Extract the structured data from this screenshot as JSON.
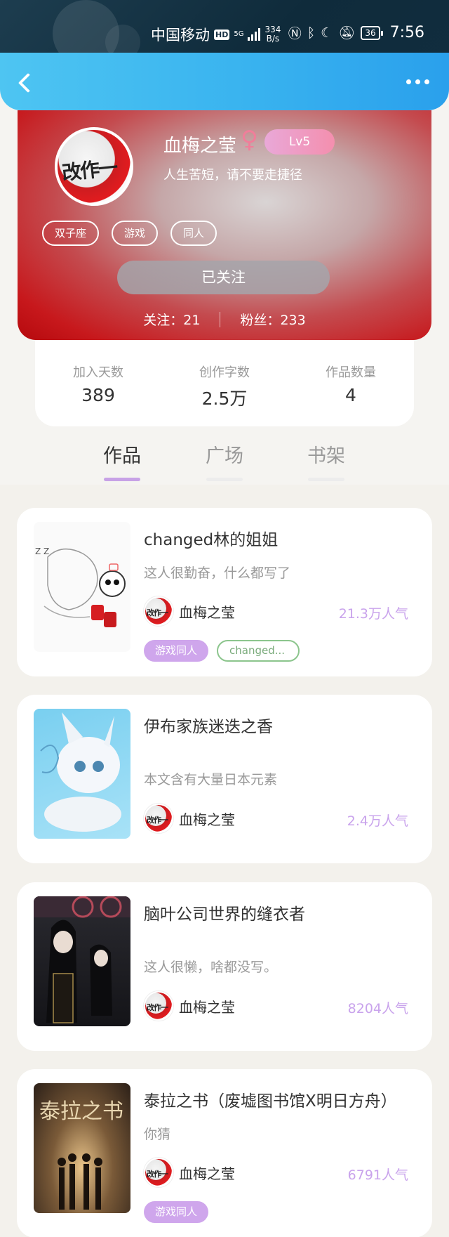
{
  "status_bar": {
    "carrier": "中国移动",
    "hd_badge": "HD",
    "network": "5G",
    "speed_value": "334",
    "speed_unit": "B/s",
    "nfc_icon": "nfc-icon",
    "bluetooth_icon": "bluetooth-icon",
    "moon_icon": "moon-icon",
    "mute_icon": "bell-off-icon",
    "battery": "36",
    "time": "7:56"
  },
  "header": {
    "back_icon": "chevron-left-icon",
    "more_icon": "more-dots-icon"
  },
  "profile": {
    "avatar_text": "改作一",
    "username": "血梅之莹",
    "gender_symbol": "♀",
    "level": "Lv5",
    "motto": "人生苦短，请不要走捷径",
    "tags": [
      "双子座",
      "游戏",
      "同人"
    ],
    "follow_button": "已关注",
    "following_label": "关注：21",
    "followers_label": "粉丝：233"
  },
  "stats": [
    {
      "label": "加入天数",
      "value": "389"
    },
    {
      "label": "创作字数",
      "value": "2.5万"
    },
    {
      "label": "作品数量",
      "value": "4"
    }
  ],
  "tabs": [
    {
      "label": "作品",
      "active": true
    },
    {
      "label": "广场",
      "active": false
    },
    {
      "label": "书架",
      "active": false
    }
  ],
  "books": [
    {
      "title": "changed林的姐姐",
      "desc": "这人很勤奋，什么都写了",
      "author": "血梅之莹",
      "popularity": "21.3万人气",
      "tags": [
        {
          "text": "游戏同人",
          "style": "purple"
        },
        {
          "text": "changed...",
          "style": "green"
        }
      ]
    },
    {
      "title": "伊布家族迷迭之香",
      "desc": "本文含有大量日本元素",
      "author": "血梅之莹",
      "popularity": "2.4万人气",
      "tags": []
    },
    {
      "title": "脑叶公司世界的缝衣者",
      "desc": "这人很懒，啥都没写。",
      "author": "血梅之莹",
      "popularity": "8204人气",
      "tags": []
    },
    {
      "title": "泰拉之书（废墟图书馆X明日方舟）",
      "desc": "你猜",
      "author": "血梅之莹",
      "popularity": "6791人气",
      "tags": [
        {
          "text": "游戏同人",
          "style": "purple"
        }
      ]
    }
  ],
  "colors": {
    "header_blue": "#39b3ef",
    "accent_purple": "#c9a3ec",
    "profile_red": "#c7181c"
  }
}
